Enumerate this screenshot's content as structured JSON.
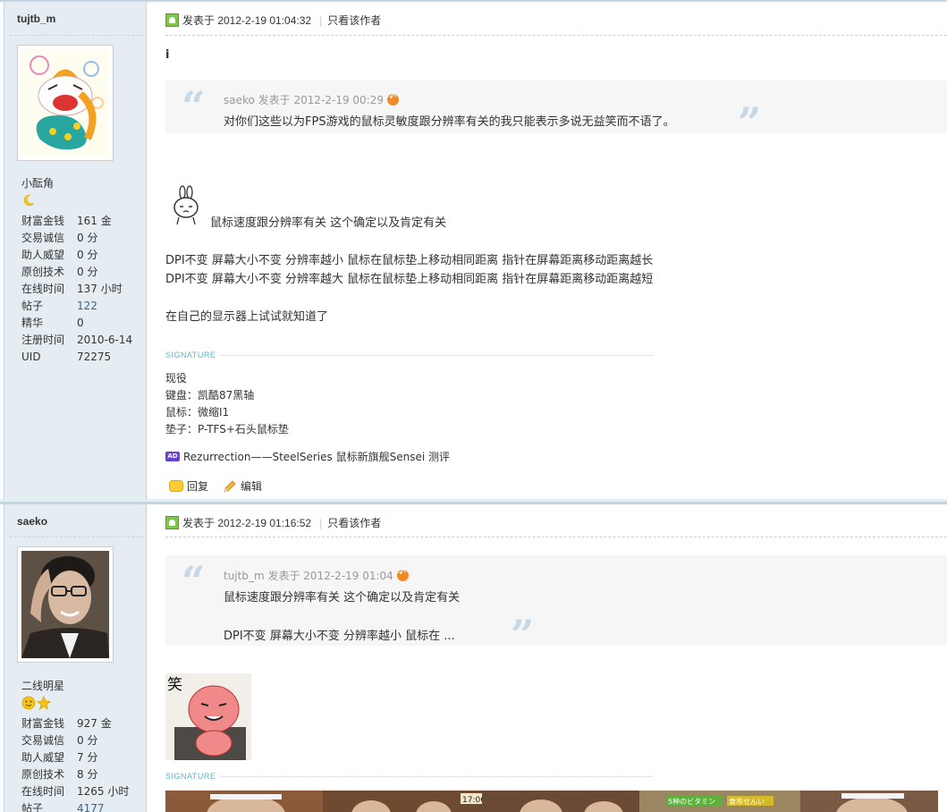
{
  "posts": [
    {
      "username": "tujtb_m",
      "rank": "小酝角",
      "stats": [
        {
          "k": "财富金钱",
          "v": "161 金"
        },
        {
          "k": "交易诚信",
          "v": "0 分"
        },
        {
          "k": "助人威望",
          "v": "0 分"
        },
        {
          "k": "原创技术",
          "v": "0 分"
        },
        {
          "k": "在线时间",
          "v": "137 小时"
        },
        {
          "k": "帖子",
          "v": "122"
        },
        {
          "k": "精华",
          "v": "0"
        },
        {
          "k": "注册时间",
          "v": "2010-6-14"
        },
        {
          "k": "UID",
          "v": "72275"
        }
      ],
      "posted_at": "发表于 2012-2-19 01:04:32",
      "author_only": "只看该作者",
      "first_line": "i",
      "quote_head": "saeko 发表于 2012-2-19 00:29",
      "quote_body": "对你们这些以为FPS游戏的鼠标灵敏度跟分辨率有关的我只能表示多说无益笑而不语了。",
      "body_line1": "鼠标速度跟分辨率有关  这个确定以及肯定有关",
      "body_line2": "DPI不变 屏幕大小不变   分辨率越小  鼠标在鼠标垫上移动相同距离     指针在屏幕距离移动距离越长",
      "body_line3": "DPI不变 屏幕大小不变   分辨率越大  鼠标在鼠标垫上移动相同距离     指针在屏幕距离移动距离越短",
      "body_line4": "在自己的显示器上试试就知道了",
      "signature_label": "SIGNATURE",
      "signature": [
        "现役",
        "键盘：凯酷87黑轴",
        "鼠标：微缩I1",
        "垫子：P-TFS+石头鼠标垫"
      ],
      "ad_icon": "AD",
      "ad_text": "Rezurrection——SteelSeries 鼠标新旗舰Sensei 测评",
      "reply": "回复",
      "edit": "编辑"
    },
    {
      "username": "saeko",
      "rank": "二线明星",
      "stats": [
        {
          "k": "财富金钱",
          "v": "927 金"
        },
        {
          "k": "交易诚信",
          "v": "0 分"
        },
        {
          "k": "助人威望",
          "v": "7 分"
        },
        {
          "k": "原创技术",
          "v": "8 分"
        },
        {
          "k": "在线时间",
          "v": "1265 小时"
        },
        {
          "k": "帖子",
          "v": "4177"
        }
      ],
      "posted_at": "发表于 2012-2-19 01:16:52",
      "author_only": "只看该作者",
      "quote_head": "tujtb_m 发表于 2012-2-19 01:04",
      "quote_line1": "鼠标速度跟分辨率有关  这个确定以及肯定有关",
      "quote_line2": "DPI不变 屏幕大小不变   分辨率越小  鼠标在 ...",
      "emoji_char": "笑",
      "signature_label": "SIGNATURE",
      "banner_text1": "5种のビタミン",
      "banner_text2": "食布せんい",
      "banner_clock": "17:06"
    }
  ]
}
